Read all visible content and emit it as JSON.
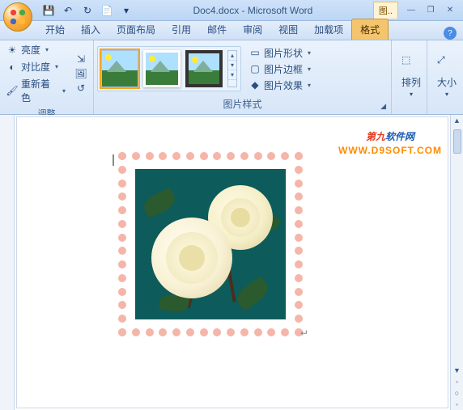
{
  "title": "Doc4.docx - Microsoft Word",
  "context_label": "图..",
  "qat": {
    "save": "💾",
    "undo": "↶",
    "redo": "↻",
    "new": "📄"
  },
  "win": {
    "min": "—",
    "max": "❐",
    "close": "✕"
  },
  "tabs": [
    {
      "label": "开始"
    },
    {
      "label": "插入"
    },
    {
      "label": "页面布局"
    },
    {
      "label": "引用"
    },
    {
      "label": "邮件"
    },
    {
      "label": "审阅"
    },
    {
      "label": "视图"
    },
    {
      "label": "加载项"
    },
    {
      "label": "格式",
      "active": true
    }
  ],
  "help": "?",
  "ribbon": {
    "adjust": {
      "label": "调整",
      "brightness": "亮度",
      "contrast": "对比度",
      "recolor": "重新着色"
    },
    "styles": {
      "label": "图片样式",
      "shape": "图片形状",
      "border": "图片边框",
      "effects": "图片效果"
    },
    "arrange": {
      "label": "排列"
    },
    "size": {
      "label": "大小"
    }
  },
  "watermark": {
    "text_red": "第九",
    "text_blue": "软件网",
    "url": "WWW.D9SOFT.COM"
  }
}
